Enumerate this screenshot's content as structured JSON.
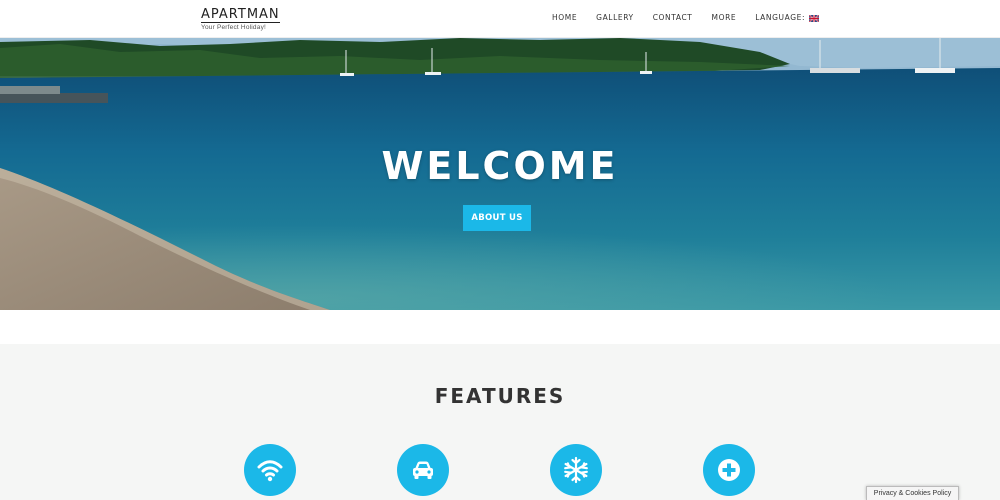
{
  "brand": {
    "title": "APARTMAN",
    "subtitle": "Your Perfect Holiday!"
  },
  "nav": {
    "items": [
      {
        "label": "HOME"
      },
      {
        "label": "GALLERY"
      },
      {
        "label": "CONTACT"
      },
      {
        "label": "MORE"
      }
    ],
    "language_label": "LANGUAGE:",
    "language_flag": "uk-flag-icon"
  },
  "hero": {
    "title": "WELCOME",
    "button_label": "ABOUT US"
  },
  "features": {
    "title": "FEATURES",
    "icons": [
      "wifi-icon",
      "car-icon",
      "snowflake-icon",
      "plus-icon"
    ]
  },
  "cookie": {
    "label": "Privacy & Cookies Policy"
  },
  "colors": {
    "accent": "#1bb8e8",
    "sea": "#1a6f94",
    "features_bg": "#f5f6f5"
  }
}
